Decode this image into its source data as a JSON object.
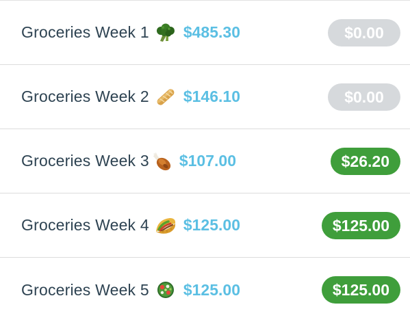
{
  "budget_list": {
    "rows": [
      {
        "name": "Groceries Week 1",
        "emoji": "broccoli-icon",
        "amount": "$485.30",
        "balance": "$0.00",
        "balance_status": "zero"
      },
      {
        "name": "Groceries Week 2",
        "emoji": "baguette-icon",
        "amount": "$146.10",
        "balance": "$0.00",
        "balance_status": "zero"
      },
      {
        "name": "Groceries Week 3",
        "emoji": "poultry-leg-icon",
        "amount": "$107.00",
        "balance": "$26.20",
        "balance_status": "positive"
      },
      {
        "name": "Groceries Week 4",
        "emoji": "taco-icon",
        "amount": "$125.00",
        "balance": "$125.00",
        "balance_status": "positive"
      },
      {
        "name": "Groceries Week 5",
        "emoji": "salad-icon",
        "amount": "$125.00",
        "balance": "$125.00",
        "balance_status": "positive"
      }
    ]
  },
  "colors": {
    "name_text": "#2e4352",
    "amount_text": "#5bbfe3",
    "zero_pill": "#d6d9dc",
    "positive_pill": "#3f9e3b",
    "divider": "#dcdcdc"
  }
}
